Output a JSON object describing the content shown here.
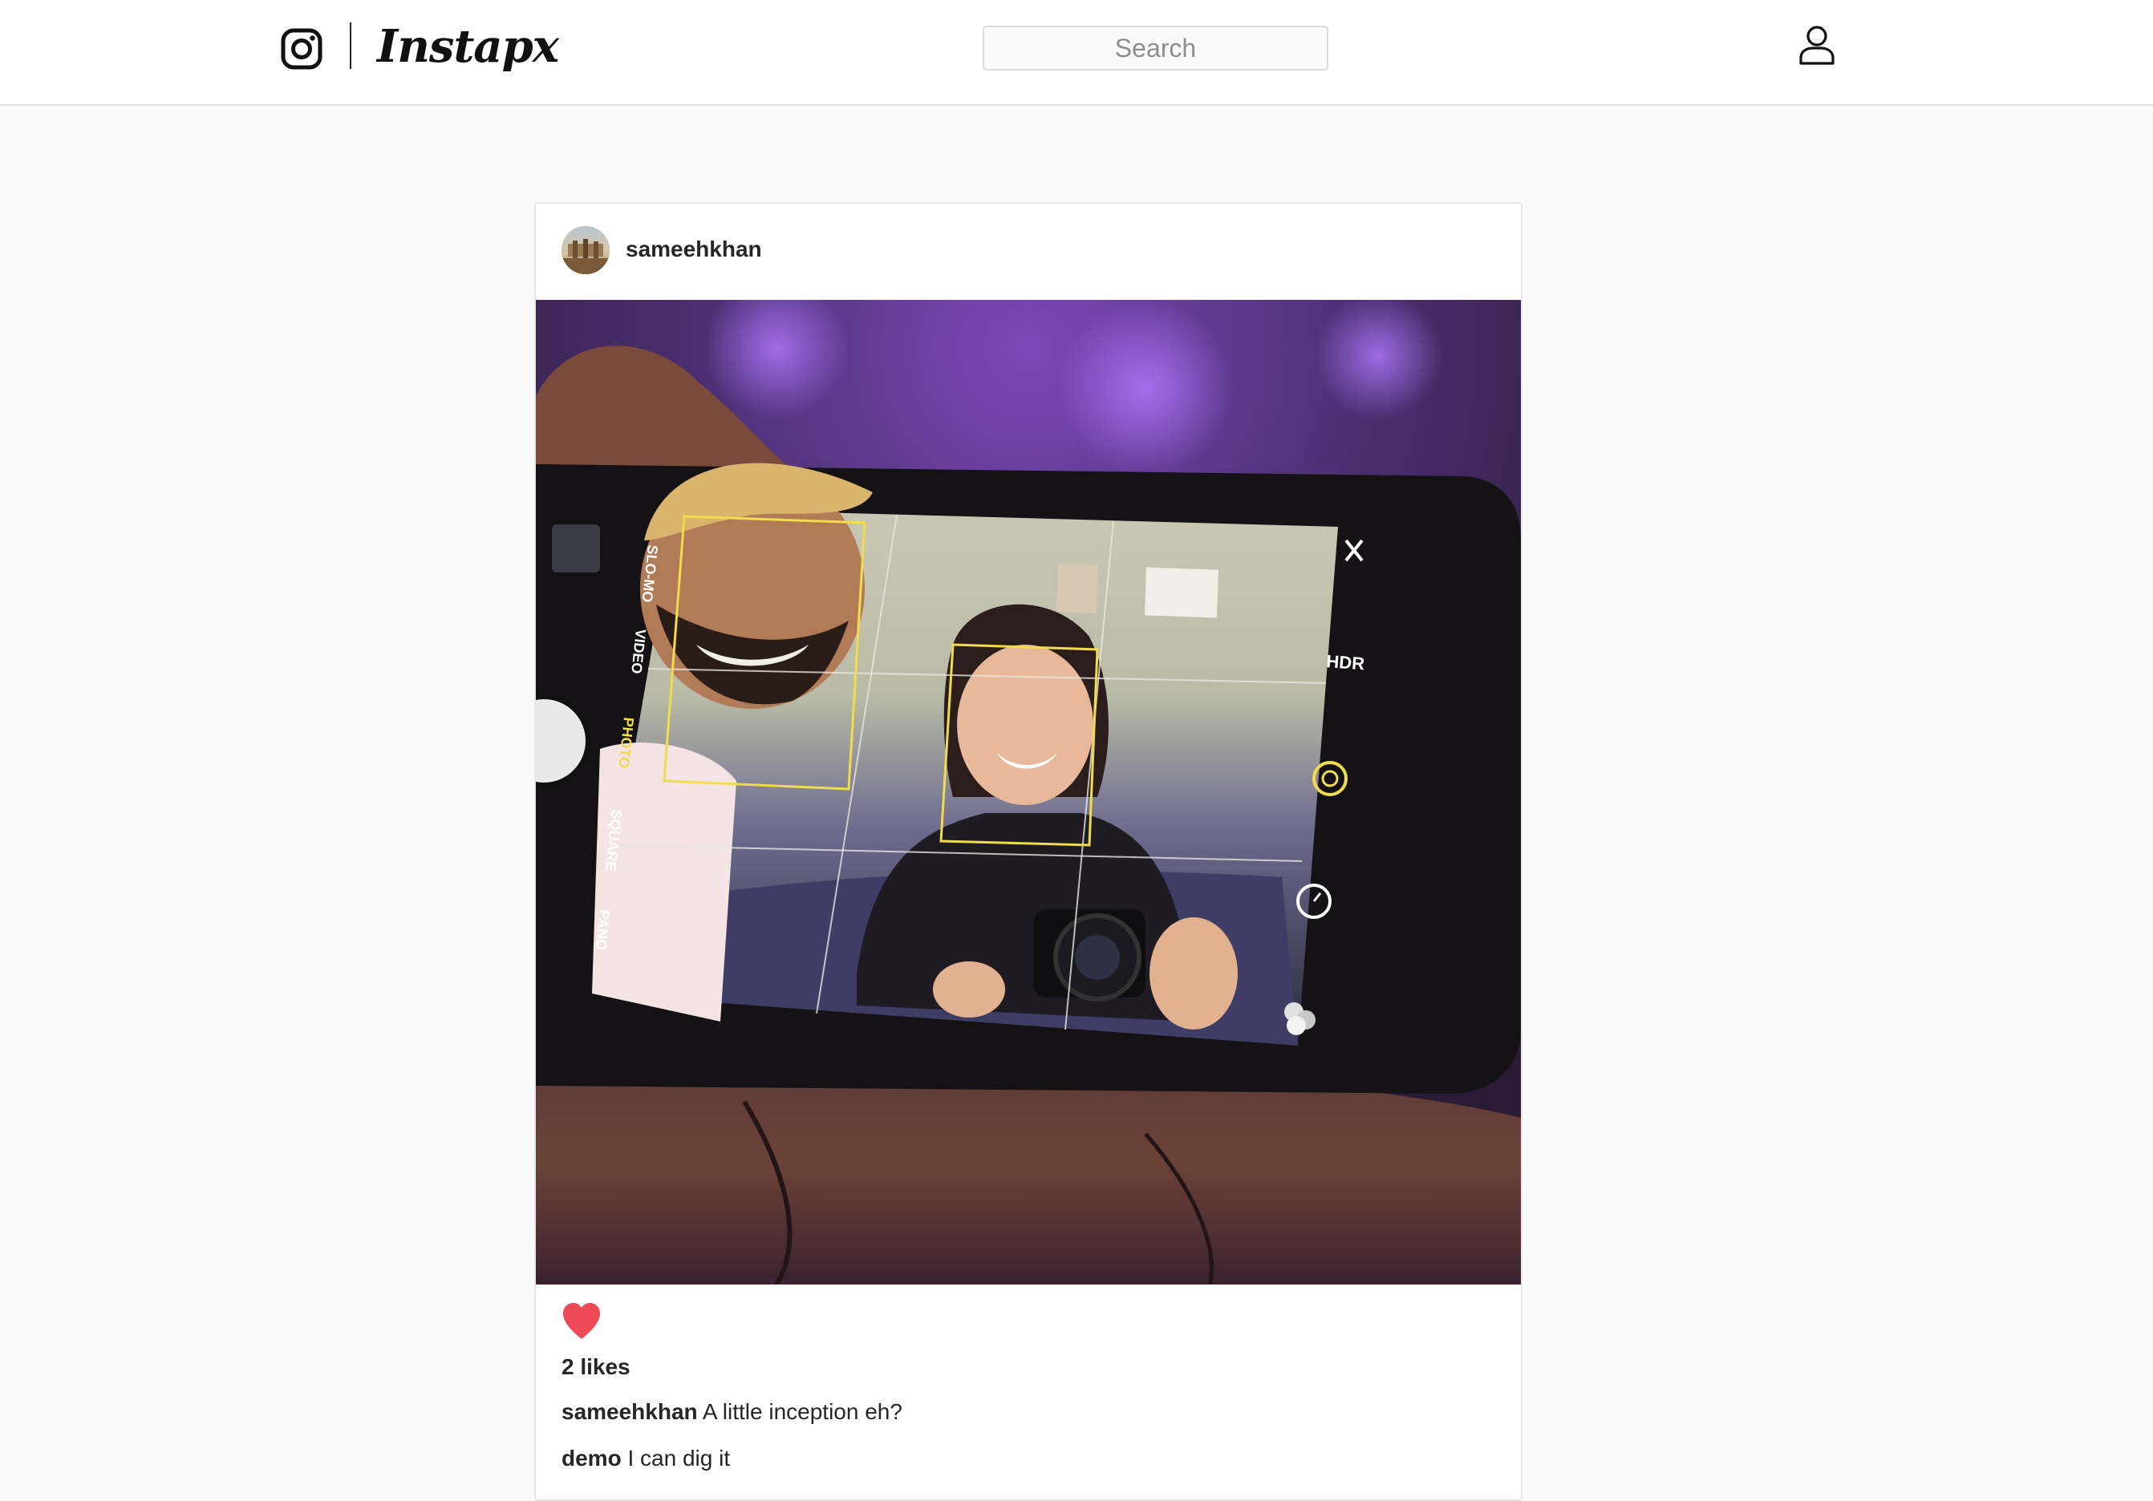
{
  "colors": {
    "accent_like": "#ed4956",
    "text": "#262626",
    "muted": "#8e8e8e",
    "border": "#dbdbdb",
    "page_background": "#fafafa"
  },
  "header": {
    "logo_icon": "instagram-camera-icon",
    "wordmark": "Instapx",
    "search": {
      "placeholder": "Search",
      "value": ""
    },
    "profile_icon": "user-profile-icon"
  },
  "post": {
    "author": "sameehkhan",
    "avatar_icon": "user-avatar",
    "liked": true,
    "like_icon": "heart-filled-icon",
    "likes_text": "2 likes",
    "comments": [
      {
        "user": "sameehkhan",
        "text": "A little inception eh?"
      },
      {
        "user": "demo",
        "text": "I can dig it"
      }
    ],
    "photo": {
      "camera_modes": [
        "SLO-MO",
        "VIDEO",
        "PHOTO",
        "SQUARE",
        "PANO"
      ],
      "selected_mode": "PHOTO",
      "hdr_label": "HDR"
    }
  }
}
